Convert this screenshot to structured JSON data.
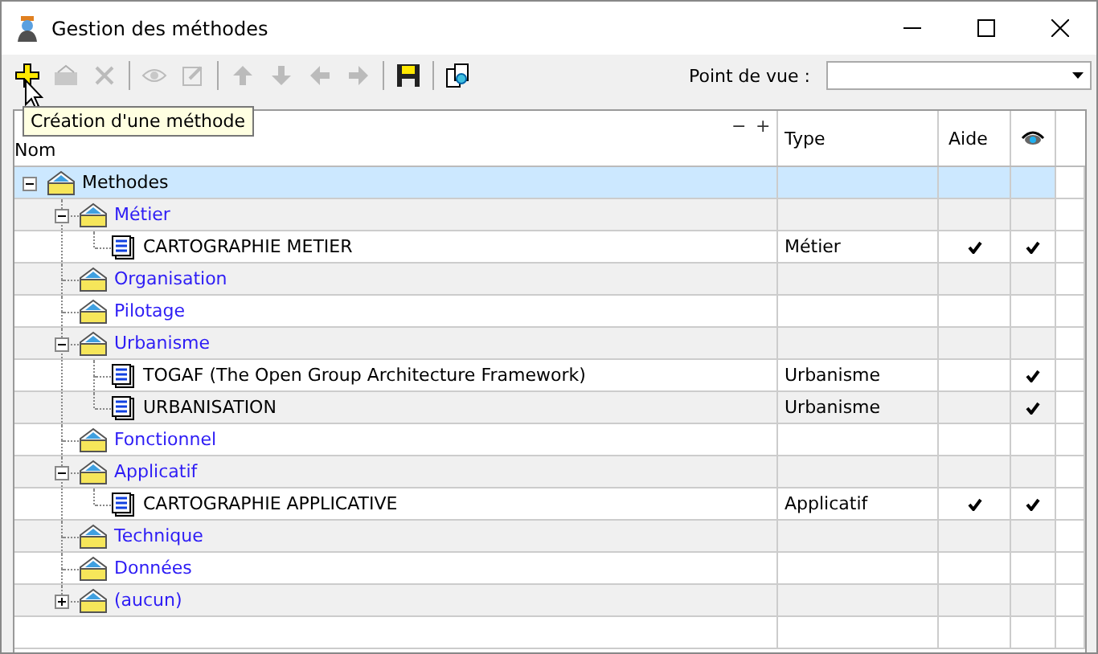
{
  "window": {
    "title": "Gestion des méthodes"
  },
  "toolbar": [
    {
      "kind": "add",
      "disabled": false
    },
    {
      "kind": "folder",
      "disabled": true
    },
    {
      "kind": "delete",
      "disabled": true
    },
    {
      "kind": "separator"
    },
    {
      "kind": "view",
      "disabled": true
    },
    {
      "kind": "edit",
      "disabled": true
    },
    {
      "kind": "separator"
    },
    {
      "kind": "up",
      "disabled": true
    },
    {
      "kind": "down",
      "disabled": true
    },
    {
      "kind": "left",
      "disabled": true
    },
    {
      "kind": "right",
      "disabled": true
    },
    {
      "kind": "separator"
    },
    {
      "kind": "save",
      "disabled": false
    },
    {
      "kind": "separator"
    },
    {
      "kind": "find",
      "disabled": false
    }
  ],
  "tooltip": "Création d'une méthode",
  "view_point": {
    "label": "Point de vue :"
  },
  "columns": [
    {
      "kind": "text",
      "label": "Nom",
      "collapse": "−",
      "expand": "+"
    },
    {
      "kind": "text",
      "label": "Type"
    },
    {
      "kind": "text",
      "label": "Aide"
    },
    {
      "kind": "eye"
    }
  ],
  "tree": [
    {
      "kind": "folder",
      "label": "Methodes",
      "selected": true,
      "expanded": true,
      "children": [
        {
          "kind": "folder",
          "label": "Métier",
          "selected": false,
          "expanded": true,
          "children": [
            {
              "kind": "method",
              "label": "CARTOGRAPHIE METIER",
              "type": "Métier",
              "aide": true,
              "visible": true,
              "selected": false
            }
          ]
        },
        {
          "kind": "folder",
          "label": "Organisation",
          "selected": false
        },
        {
          "kind": "folder",
          "label": "Pilotage",
          "selected": false
        },
        {
          "kind": "folder",
          "label": "Urbanisme",
          "selected": false,
          "expanded": true,
          "children": [
            {
              "kind": "method",
              "label": "TOGAF (The Open Group Architecture Framework)",
              "type": "Urbanisme",
              "aide": false,
              "visible": true,
              "selected": false
            },
            {
              "kind": "method",
              "label": "URBANISATION",
              "type": "Urbanisme",
              "aide": false,
              "visible": true,
              "selected": false
            }
          ]
        },
        {
          "kind": "folder",
          "label": "Fonctionnel",
          "selected": false
        },
        {
          "kind": "folder",
          "label": "Applicatif",
          "selected": false,
          "expanded": true,
          "children": [
            {
              "kind": "method",
              "label": "CARTOGRAPHIE APPLICATIVE",
              "type": "Applicatif",
              "aide": true,
              "visible": true,
              "selected": false
            }
          ]
        },
        {
          "kind": "folder",
          "label": "Technique",
          "selected": false
        },
        {
          "kind": "folder",
          "label": "Données",
          "selected": false
        },
        {
          "kind": "folder",
          "label": "(aucun)",
          "selected": false,
          "expanded": false
        }
      ]
    }
  ]
}
